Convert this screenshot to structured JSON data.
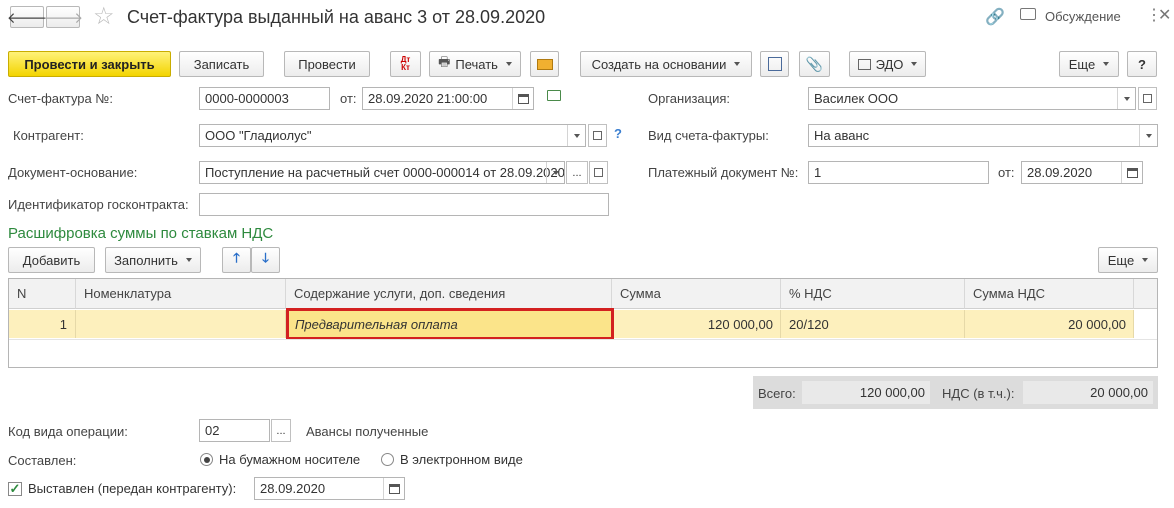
{
  "window": {
    "title": "Счет-фактура выданный на аванс 3 от 28.09.2020",
    "discussion_label": "Обсуждение"
  },
  "toolbar": {
    "post_close": "Провести и закрыть",
    "save": "Записать",
    "post": "Провести",
    "dtkt_top": "Дт",
    "dtkt_bottom": "Кт",
    "print": "Печать",
    "create_based_on": "Создать на основании",
    "edo": "ЭДО",
    "more": "Еще",
    "help": "?"
  },
  "form": {
    "invoice_no_label": "Счет-фактура №:",
    "invoice_no": "0000-0000003",
    "from_label": "от:",
    "invoice_date": "28.09.2020 21:00:00",
    "org_label": "Организация:",
    "org": "Василек ООО",
    "counterparty_label": "Контрагент:",
    "counterparty": "ООО \"Гладиолус\"",
    "question": "?",
    "invoice_type_label": "Вид счета-фактуры:",
    "invoice_type": "На аванс",
    "base_doc_label": "Документ-основание:",
    "base_doc": "Поступление на расчетный счет 0000-000014 от 28.09.2020",
    "ellipsis": "...",
    "payment_doc_label": "Платежный документ №:",
    "payment_doc": "1",
    "payment_from_label": "от:",
    "payment_date": "28.09.2020",
    "gov_contract_label": "Идентификатор госконтракта:",
    "gov_contract": ""
  },
  "section": {
    "title": "Расшифровка суммы по ставкам НДС",
    "add": "Добавить",
    "fill": "Заполнить",
    "more": "Еще"
  },
  "table": {
    "columns": [
      "N",
      "Номенклатура",
      "Содержание услуги, доп. сведения",
      "Сумма",
      "% НДС",
      "Сумма НДС"
    ],
    "rows": [
      {
        "n": "1",
        "nomenclature": "",
        "content": "Предварительная оплата",
        "sum": "120 000,00",
        "vat_rate": "20/120",
        "vat_sum": "20 000,00"
      }
    ]
  },
  "totals": {
    "total_label": "Всего:",
    "total": "120 000,00",
    "vat_label": "НДС (в т.ч.):",
    "vat": "20 000,00"
  },
  "footer": {
    "op_code_label": "Код вида операции:",
    "op_code": "02",
    "op_code_btn": "...",
    "op_code_desc": "Авансы полученные",
    "composed_label": "Составлен:",
    "paper": "На бумажном носителе",
    "electronic": "В электронном виде",
    "issued_label": "Выставлен (передан контрагенту):",
    "issued_date": "28.09.2020"
  },
  "colors": {
    "primary_button": "#f3d400",
    "section_title": "#2e8a3e",
    "row_highlight": "#fdf0bd",
    "selection_border": "#d32020"
  }
}
